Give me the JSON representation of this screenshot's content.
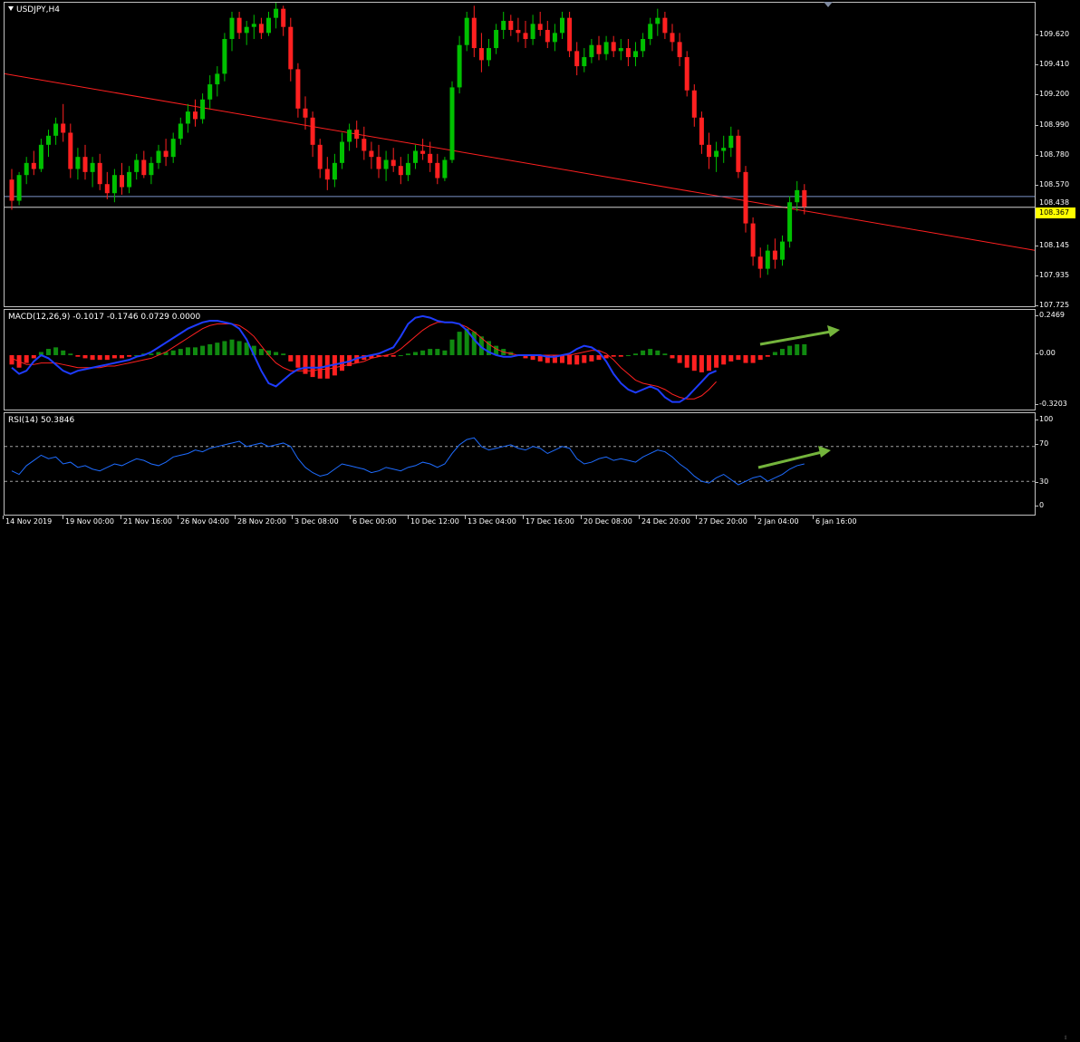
{
  "window": {
    "symbol_title": "USDJPY,H4"
  },
  "colors": {
    "bull": "#00c000",
    "bear": "#ff2020",
    "trendline": "#ff2020",
    "bid_line": "#d0d0d0",
    "ask_line": "#7d93c9",
    "macd_main": "#1e3cff",
    "macd_signal": "#ff2020",
    "rsi_line": "#1e6cff",
    "arrow": "#74b43c",
    "price_tag_bg": "#ffff00"
  },
  "main": {
    "price_labels": [
      "109.620",
      "109.410",
      "109.200",
      "108.990",
      "108.780",
      "108.570",
      "108.145",
      "107.935",
      "107.725"
    ],
    "ask_price": "108.438",
    "bid_price": "108.367",
    "price_range": [
      107.7,
      109.72
    ],
    "trendline": {
      "start": 109.25,
      "end": 108.08
    },
    "ohlc": [
      [
        108.55,
        108.62,
        108.35,
        108.41
      ],
      [
        108.41,
        108.6,
        108.38,
        108.58
      ],
      [
        108.58,
        108.7,
        108.52,
        108.66
      ],
      [
        108.66,
        108.74,
        108.58,
        108.62
      ],
      [
        108.62,
        108.82,
        108.6,
        108.78
      ],
      [
        108.78,
        108.88,
        108.7,
        108.84
      ],
      [
        108.84,
        108.96,
        108.78,
        108.92
      ],
      [
        108.92,
        109.05,
        108.8,
        108.86
      ],
      [
        108.86,
        108.92,
        108.56,
        108.62
      ],
      [
        108.62,
        108.76,
        108.55,
        108.7
      ],
      [
        108.7,
        108.78,
        108.55,
        108.6
      ],
      [
        108.6,
        108.7,
        108.5,
        108.66
      ],
      [
        108.66,
        108.72,
        108.48,
        108.52
      ],
      [
        108.52,
        108.6,
        108.42,
        108.46
      ],
      [
        108.46,
        108.62,
        108.4,
        108.58
      ],
      [
        108.58,
        108.66,
        108.45,
        108.5
      ],
      [
        108.5,
        108.64,
        108.46,
        108.6
      ],
      [
        108.6,
        108.72,
        108.55,
        108.68
      ],
      [
        108.68,
        108.74,
        108.56,
        108.58
      ],
      [
        108.58,
        108.7,
        108.52,
        108.66
      ],
      [
        108.66,
        108.78,
        108.62,
        108.74
      ],
      [
        108.74,
        108.82,
        108.64,
        108.7
      ],
      [
        108.7,
        108.86,
        108.66,
        108.82
      ],
      [
        108.82,
        108.96,
        108.78,
        108.92
      ],
      [
        108.92,
        109.05,
        108.86,
        109.0
      ],
      [
        109.0,
        109.08,
        108.9,
        108.95
      ],
      [
        108.95,
        109.12,
        108.92,
        109.08
      ],
      [
        109.08,
        109.24,
        109.02,
        109.18
      ],
      [
        109.18,
        109.3,
        109.1,
        109.25
      ],
      [
        109.25,
        109.52,
        109.2,
        109.48
      ],
      [
        109.48,
        109.66,
        109.4,
        109.62
      ],
      [
        109.62,
        109.66,
        109.48,
        109.52
      ],
      [
        109.52,
        109.6,
        109.44,
        109.56
      ],
      [
        109.56,
        109.64,
        109.48,
        109.58
      ],
      [
        109.58,
        109.62,
        109.48,
        109.52
      ],
      [
        109.52,
        109.66,
        109.5,
        109.62
      ],
      [
        109.62,
        109.74,
        109.55,
        109.68
      ],
      [
        109.68,
        109.7,
        109.5,
        109.56
      ],
      [
        109.56,
        109.62,
        109.2,
        109.28
      ],
      [
        109.28,
        109.32,
        108.96,
        109.02
      ],
      [
        109.02,
        109.1,
        108.88,
        108.96
      ],
      [
        108.96,
        109.0,
        108.7,
        108.78
      ],
      [
        108.78,
        108.82,
        108.56,
        108.62
      ],
      [
        108.62,
        108.7,
        108.48,
        108.55
      ],
      [
        108.55,
        108.72,
        108.5,
        108.66
      ],
      [
        108.66,
        108.86,
        108.62,
        108.8
      ],
      [
        108.8,
        108.92,
        108.74,
        108.88
      ],
      [
        108.88,
        108.94,
        108.76,
        108.82
      ],
      [
        108.82,
        108.9,
        108.68,
        108.74
      ],
      [
        108.74,
        108.8,
        108.62,
        108.7
      ],
      [
        108.7,
        108.78,
        108.56,
        108.62
      ],
      [
        108.62,
        108.74,
        108.54,
        108.68
      ],
      [
        108.68,
        108.76,
        108.6,
        108.64
      ],
      [
        108.64,
        108.7,
        108.52,
        108.58
      ],
      [
        108.58,
        108.72,
        108.54,
        108.66
      ],
      [
        108.66,
        108.78,
        108.62,
        108.74
      ],
      [
        108.74,
        108.82,
        108.68,
        108.72
      ],
      [
        108.72,
        108.8,
        108.6,
        108.66
      ],
      [
        108.66,
        108.72,
        108.52,
        108.56
      ],
      [
        108.56,
        108.7,
        108.54,
        108.68
      ],
      [
        108.68,
        109.2,
        108.66,
        109.16
      ],
      [
        109.16,
        109.5,
        109.12,
        109.44
      ],
      [
        109.44,
        109.66,
        109.4,
        109.62
      ],
      [
        109.62,
        109.7,
        109.36,
        109.42
      ],
      [
        109.42,
        109.52,
        109.26,
        109.34
      ],
      [
        109.34,
        109.48,
        109.3,
        109.42
      ],
      [
        109.42,
        109.58,
        109.38,
        109.54
      ],
      [
        109.54,
        109.66,
        109.48,
        109.6
      ],
      [
        109.6,
        109.64,
        109.5,
        109.54
      ],
      [
        109.54,
        109.62,
        109.46,
        109.52
      ],
      [
        109.52,
        109.6,
        109.42,
        109.48
      ],
      [
        109.48,
        109.64,
        109.44,
        109.58
      ],
      [
        109.58,
        109.66,
        109.5,
        109.54
      ],
      [
        109.54,
        109.6,
        109.42,
        109.46
      ],
      [
        109.46,
        109.58,
        109.4,
        109.52
      ],
      [
        109.52,
        109.66,
        109.48,
        109.62
      ],
      [
        109.62,
        109.66,
        109.36,
        109.4
      ],
      [
        109.4,
        109.46,
        109.24,
        109.3
      ],
      [
        109.3,
        109.42,
        109.26,
        109.36
      ],
      [
        109.36,
        109.48,
        109.32,
        109.44
      ],
      [
        109.44,
        109.5,
        109.34,
        109.38
      ],
      [
        109.38,
        109.5,
        109.34,
        109.46
      ],
      [
        109.46,
        109.5,
        109.36,
        109.4
      ],
      [
        109.4,
        109.48,
        109.34,
        109.42
      ],
      [
        109.42,
        109.48,
        109.3,
        109.36
      ],
      [
        109.36,
        109.46,
        109.3,
        109.4
      ],
      [
        109.4,
        109.52,
        109.36,
        109.48
      ],
      [
        109.48,
        109.62,
        109.44,
        109.58
      ],
      [
        109.58,
        109.68,
        109.5,
        109.62
      ],
      [
        109.62,
        109.66,
        109.48,
        109.52
      ],
      [
        109.52,
        109.58,
        109.4,
        109.46
      ],
      [
        109.46,
        109.52,
        109.3,
        109.36
      ],
      [
        109.36,
        109.4,
        109.1,
        109.14
      ],
      [
        109.14,
        109.18,
        108.9,
        108.96
      ],
      [
        108.96,
        109.0,
        108.72,
        108.78
      ],
      [
        108.78,
        108.86,
        108.62,
        108.7
      ],
      [
        108.7,
        108.8,
        108.6,
        108.74
      ],
      [
        108.74,
        108.84,
        108.66,
        108.76
      ],
      [
        108.76,
        108.9,
        108.7,
        108.84
      ],
      [
        108.84,
        108.88,
        108.56,
        108.6
      ],
      [
        108.6,
        108.64,
        108.2,
        108.26
      ],
      [
        108.26,
        108.3,
        107.98,
        108.04
      ],
      [
        108.04,
        108.1,
        107.9,
        107.96
      ],
      [
        107.96,
        108.12,
        107.92,
        108.08
      ],
      [
        108.08,
        108.16,
        107.96,
        108.02
      ],
      [
        108.02,
        108.18,
        107.98,
        108.14
      ],
      [
        108.14,
        108.44,
        108.1,
        108.4
      ],
      [
        108.4,
        108.54,
        108.34,
        108.48
      ],
      [
        108.48,
        108.52,
        108.32,
        108.37
      ]
    ]
  },
  "macd": {
    "title": "MACD(12,26,9) -0.1017 -0.1746 0.0729 0.0000",
    "labels": [
      "0.2469",
      "0.00",
      "-0.3203"
    ],
    "range": [
      -0.36,
      0.29
    ],
    "hist": [
      -0.06,
      -0.08,
      -0.05,
      -0.02,
      0.02,
      0.04,
      0.05,
      0.03,
      0.01,
      -0.01,
      -0.02,
      -0.03,
      -0.03,
      -0.03,
      -0.02,
      -0.02,
      -0.01,
      0.0,
      0.01,
      0.01,
      0.02,
      0.02,
      0.03,
      0.04,
      0.05,
      0.05,
      0.06,
      0.07,
      0.08,
      0.09,
      0.1,
      0.09,
      0.08,
      0.06,
      0.04,
      0.03,
      0.02,
      0.01,
      -0.04,
      -0.08,
      -0.12,
      -0.14,
      -0.15,
      -0.15,
      -0.13,
      -0.1,
      -0.07,
      -0.05,
      -0.03,
      -0.02,
      -0.01,
      -0.01,
      -0.01,
      0.0,
      0.01,
      0.02,
      0.03,
      0.04,
      0.04,
      0.03,
      0.1,
      0.15,
      0.17,
      0.15,
      0.12,
      0.09,
      0.06,
      0.04,
      0.02,
      0.0,
      -0.02,
      -0.03,
      -0.04,
      -0.05,
      -0.05,
      -0.05,
      -0.06,
      -0.06,
      -0.05,
      -0.04,
      -0.03,
      -0.02,
      -0.01,
      -0.01,
      0.0,
      0.01,
      0.03,
      0.04,
      0.03,
      0.01,
      -0.02,
      -0.05,
      -0.08,
      -0.1,
      -0.11,
      -0.1,
      -0.08,
      -0.06,
      -0.04,
      -0.03,
      -0.05,
      -0.05,
      -0.03,
      -0.01,
      0.02,
      0.04,
      0.06,
      0.07,
      0.07
    ],
    "main": [
      -0.08,
      -0.12,
      -0.1,
      -0.04,
      0.0,
      -0.02,
      -0.06,
      -0.1,
      -0.12,
      -0.1,
      -0.09,
      -0.08,
      -0.07,
      -0.06,
      -0.05,
      -0.04,
      -0.03,
      -0.01,
      0.0,
      0.02,
      0.05,
      0.08,
      0.11,
      0.14,
      0.17,
      0.19,
      0.21,
      0.22,
      0.22,
      0.21,
      0.2,
      0.17,
      0.1,
      0.0,
      -0.1,
      -0.18,
      -0.2,
      -0.16,
      -0.12,
      -0.09,
      -0.08,
      -0.08,
      -0.08,
      -0.07,
      -0.06,
      -0.05,
      -0.04,
      -0.02,
      -0.01,
      0.0,
      0.01,
      0.03,
      0.05,
      0.12,
      0.2,
      0.24,
      0.25,
      0.24,
      0.22,
      0.21,
      0.21,
      0.2,
      0.16,
      0.1,
      0.05,
      0.02,
      0.0,
      -0.01,
      -0.01,
      0.0,
      0.0,
      0.0,
      0.0,
      -0.01,
      -0.01,
      0.0,
      0.01,
      0.04,
      0.06,
      0.05,
      0.02,
      -0.04,
      -0.12,
      -0.18,
      -0.22,
      -0.24,
      -0.22,
      -0.2,
      -0.22,
      -0.27,
      -0.3,
      -0.3,
      -0.27,
      -0.22,
      -0.17,
      -0.12,
      -0.1
    ],
    "signal": [
      -0.02,
      -0.04,
      -0.06,
      -0.06,
      -0.05,
      -0.05,
      -0.05,
      -0.06,
      -0.07,
      -0.08,
      -0.08,
      -0.08,
      -0.08,
      -0.07,
      -0.07,
      -0.06,
      -0.05,
      -0.04,
      -0.03,
      -0.02,
      0.0,
      0.02,
      0.05,
      0.08,
      0.11,
      0.14,
      0.17,
      0.19,
      0.2,
      0.2,
      0.2,
      0.19,
      0.16,
      0.12,
      0.06,
      0.0,
      -0.05,
      -0.08,
      -0.1,
      -0.1,
      -0.1,
      -0.1,
      -0.09,
      -0.09,
      -0.08,
      -0.07,
      -0.06,
      -0.05,
      -0.04,
      -0.02,
      -0.01,
      0.0,
      0.01,
      0.04,
      0.08,
      0.12,
      0.16,
      0.19,
      0.21,
      0.21,
      0.21,
      0.2,
      0.18,
      0.15,
      0.11,
      0.07,
      0.04,
      0.02,
      0.01,
      0.0,
      0.0,
      0.0,
      0.0,
      0.0,
      0.0,
      0.0,
      0.0,
      0.01,
      0.02,
      0.03,
      0.03,
      0.01,
      -0.03,
      -0.08,
      -0.12,
      -0.16,
      -0.18,
      -0.19,
      -0.2,
      -0.22,
      -0.25,
      -0.27,
      -0.28,
      -0.28,
      -0.26,
      -0.22,
      -0.17
    ]
  },
  "rsi": {
    "title": "RSI(14) 50.3846",
    "labels": [
      "100",
      "70",
      "30",
      "0"
    ],
    "levels": [
      70,
      30
    ],
    "values": [
      42,
      38,
      48,
      54,
      60,
      56,
      58,
      50,
      52,
      46,
      48,
      44,
      42,
      46,
      50,
      48,
      52,
      56,
      54,
      50,
      48,
      52,
      58,
      60,
      62,
      66,
      64,
      68,
      70,
      72,
      74,
      76,
      70,
      72,
      74,
      70,
      72,
      74,
      70,
      56,
      46,
      40,
      36,
      38,
      44,
      50,
      48,
      46,
      44,
      40,
      42,
      46,
      44,
      42,
      46,
      48,
      52,
      50,
      46,
      50,
      62,
      72,
      78,
      80,
      70,
      66,
      68,
      70,
      72,
      68,
      66,
      70,
      68,
      62,
      66,
      70,
      68,
      56,
      50,
      52,
      56,
      58,
      54,
      56,
      54,
      52,
      58,
      62,
      66,
      64,
      58,
      50,
      44,
      36,
      30,
      28,
      34,
      38,
      32,
      26,
      30,
      34,
      36,
      30,
      34,
      38,
      44,
      48,
      50
    ]
  },
  "time_labels": [
    "14 Nov 2019",
    "19 Nov 00:00",
    "21 Nov 16:00",
    "26 Nov 04:00",
    "28 Nov 20:00",
    "3 Dec 08:00",
    "6 Dec 00:00",
    "10 Dec 12:00",
    "13 Dec 04:00",
    "17 Dec 16:00",
    "20 Dec 08:00",
    "24 Dec 20:00",
    "27 Dec 20:00",
    "2 Jan 04:00",
    "6 Jan 16:00"
  ]
}
